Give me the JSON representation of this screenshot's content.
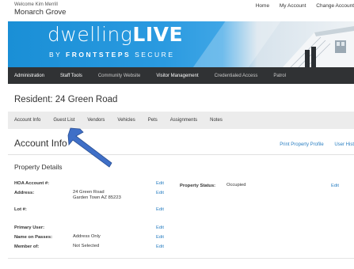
{
  "header": {
    "welcome": "Welcome Kim Merrill",
    "community": "Monarch Grove",
    "links": [
      "Home",
      "My Account",
      "Change Account"
    ]
  },
  "banner": {
    "logo_main_a": "dwelling",
    "logo_main_b": "LIVE",
    "logo_sub_a": "BY ",
    "logo_sub_b": "FRONTSTEPS",
    "logo_sub_c": " SECURE"
  },
  "nav": {
    "items": [
      "Administration",
      "Staff Tools",
      "Community Website",
      "Visitor Management",
      "Credentialed Access",
      "Patrol"
    ]
  },
  "page": {
    "title": "Resident: 24 Green Road"
  },
  "tabs": [
    "Account Info",
    "Guest List",
    "Vendors",
    "Vehicles",
    "Pets",
    "Assignments",
    "Notes"
  ],
  "account": {
    "title": "Account Info",
    "links": [
      "Print Property Profile",
      "User Hist"
    ]
  },
  "details": {
    "title": "Property Details",
    "edit_label": "Edit",
    "hoa_label": "HOA Account #:",
    "address_label": "Address:",
    "address_line1": "24 Green Road",
    "address_line2": "Garden Town AZ 85223",
    "lot_label": "Lot #:",
    "primary_user_label": "Primary User:",
    "name_on_passes_label": "Name on Passes:",
    "name_on_passes_value": "Address Only",
    "member_of_label": "Member of:",
    "member_of_value": "Not Selected",
    "property_status_label": "Property Status:",
    "property_status_value": "Occupied"
  },
  "colors": {
    "banner_blue": "#1a8fd6",
    "nav_bg": "#303234",
    "link_blue": "#2a7fc2",
    "arrow_blue": "#3f6fc7"
  }
}
